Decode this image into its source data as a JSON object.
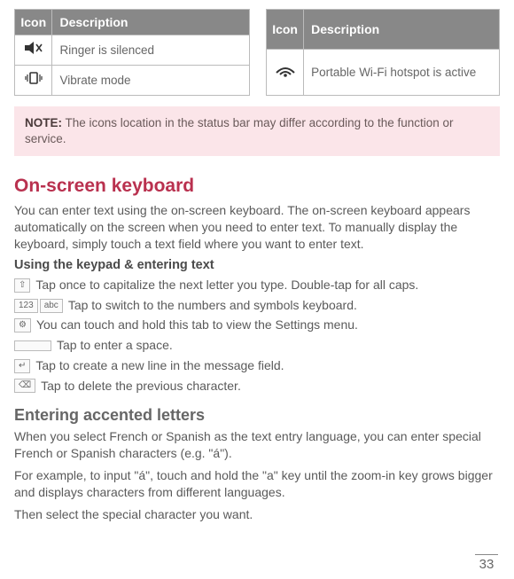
{
  "tableLeft": {
    "headers": {
      "icon": "Icon",
      "desc": "Description"
    },
    "rows": [
      {
        "icon": "speaker-mute-icon",
        "desc": "Ringer is silenced"
      },
      {
        "icon": "vibrate-icon",
        "desc": "Vibrate mode"
      }
    ]
  },
  "tableRight": {
    "headers": {
      "icon": "Icon",
      "desc": "Description"
    },
    "rows": [
      {
        "icon": "wifi-hotspot-icon",
        "desc": "Portable Wi-Fi hotspot is active"
      }
    ]
  },
  "note": {
    "label": "NOTE:",
    "text": " The icons location in the status bar may differ according to the function or service."
  },
  "section1": {
    "heading": "On-screen keyboard",
    "para": "You can enter text using the on-screen keyboard. The on-screen keyboard appears automatically on the screen when you need to enter text. To manually display the keyboard, simply touch a text field where you want to enter text.",
    "subhead": "Using the keypad & entering text",
    "lines": [
      {
        "icon": "shift",
        "text": " Tap once to capitalize the next letter you type. Double-tap for all caps."
      },
      {
        "icon": "numsym",
        "text": " Tap to switch to the numbers and symbols keyboard."
      },
      {
        "icon": "settings",
        "text": " You can touch and hold this tab to view the Settings menu."
      },
      {
        "icon": "space",
        "text": " Tap to enter a space."
      },
      {
        "icon": "enter",
        "text": " Tap to create a new line in the message field."
      },
      {
        "icon": "backspace",
        "text": " Tap to delete the previous character."
      }
    ]
  },
  "section2": {
    "heading": "Entering accented letters",
    "para1": "When you select French or Spanish as the text entry language, you can enter special French or Spanish characters (e.g. \"á\").",
    "para2": "For example, to input \"á\", touch and hold the \"a\" key until the zoom-in key grows bigger and displays characters from different languages.",
    "para3": "Then select the special character you want."
  },
  "pageNumber": "33"
}
